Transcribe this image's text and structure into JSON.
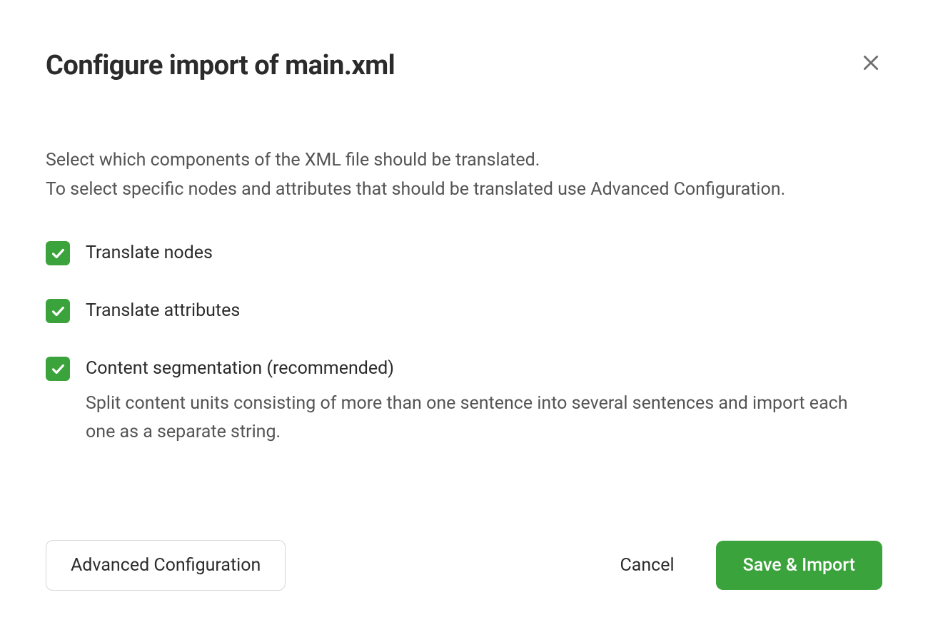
{
  "dialog": {
    "title": "Configure import of main.xml",
    "description_line1": "Select which components of the XML file should be translated.",
    "description_line2": "To select specific nodes and attributes that should be translated use Advanced Configuration."
  },
  "options": [
    {
      "label": "Translate nodes",
      "checked": true,
      "help": ""
    },
    {
      "label": "Translate attributes",
      "checked": true,
      "help": ""
    },
    {
      "label": "Content segmentation (recommended)",
      "checked": true,
      "help": "Split content units consisting of more than one sentence into several sentences and import each one as a separate string."
    }
  ],
  "footer": {
    "advanced": "Advanced Configuration",
    "cancel": "Cancel",
    "save": "Save & Import"
  },
  "colors": {
    "accent": "#3ba33b"
  }
}
